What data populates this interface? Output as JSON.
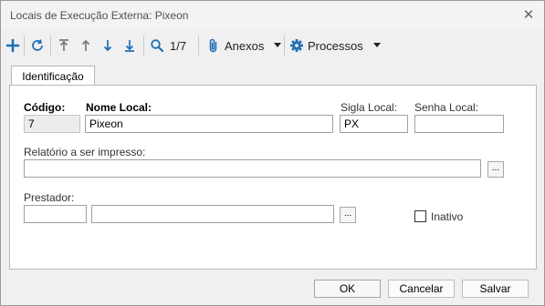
{
  "window": {
    "title": "Locais de Execução Externa: Pixeon",
    "close_glyph": "✕"
  },
  "toolbar": {
    "counter": "1/7",
    "attachments_label": "Anexos",
    "processes_label": "Processos",
    "icons": [
      "plus-icon",
      "refresh-icon",
      "first-record-icon",
      "previous-record-icon",
      "next-record-icon",
      "last-record-icon",
      "search-icon",
      "paperclip-icon",
      "gear-icon",
      "chevron-down-icon"
    ],
    "accent_color": "#1f6fb5"
  },
  "tabs": [
    {
      "label": "Identificação",
      "selected": true
    }
  ],
  "form": {
    "codigo_label": "Código:",
    "codigo_value": "7",
    "nome_label": "Nome Local:",
    "nome_value": "Pixeon",
    "sigla_label": "Sigla Local:",
    "sigla_value": "PX",
    "senha_label": "Senha Local:",
    "senha_value": "",
    "relatorio_label": "Relatório a ser impresso:",
    "relatorio_value": "",
    "prestador_label": "Prestador:",
    "prestador_code_value": "",
    "prestador_name_value": "",
    "ellipsis": "...",
    "inativo_label": "Inativo",
    "inativo_checked": false
  },
  "footer": {
    "ok_label": "OK",
    "cancel_label": "Cancelar",
    "save_label": "Salvar"
  }
}
